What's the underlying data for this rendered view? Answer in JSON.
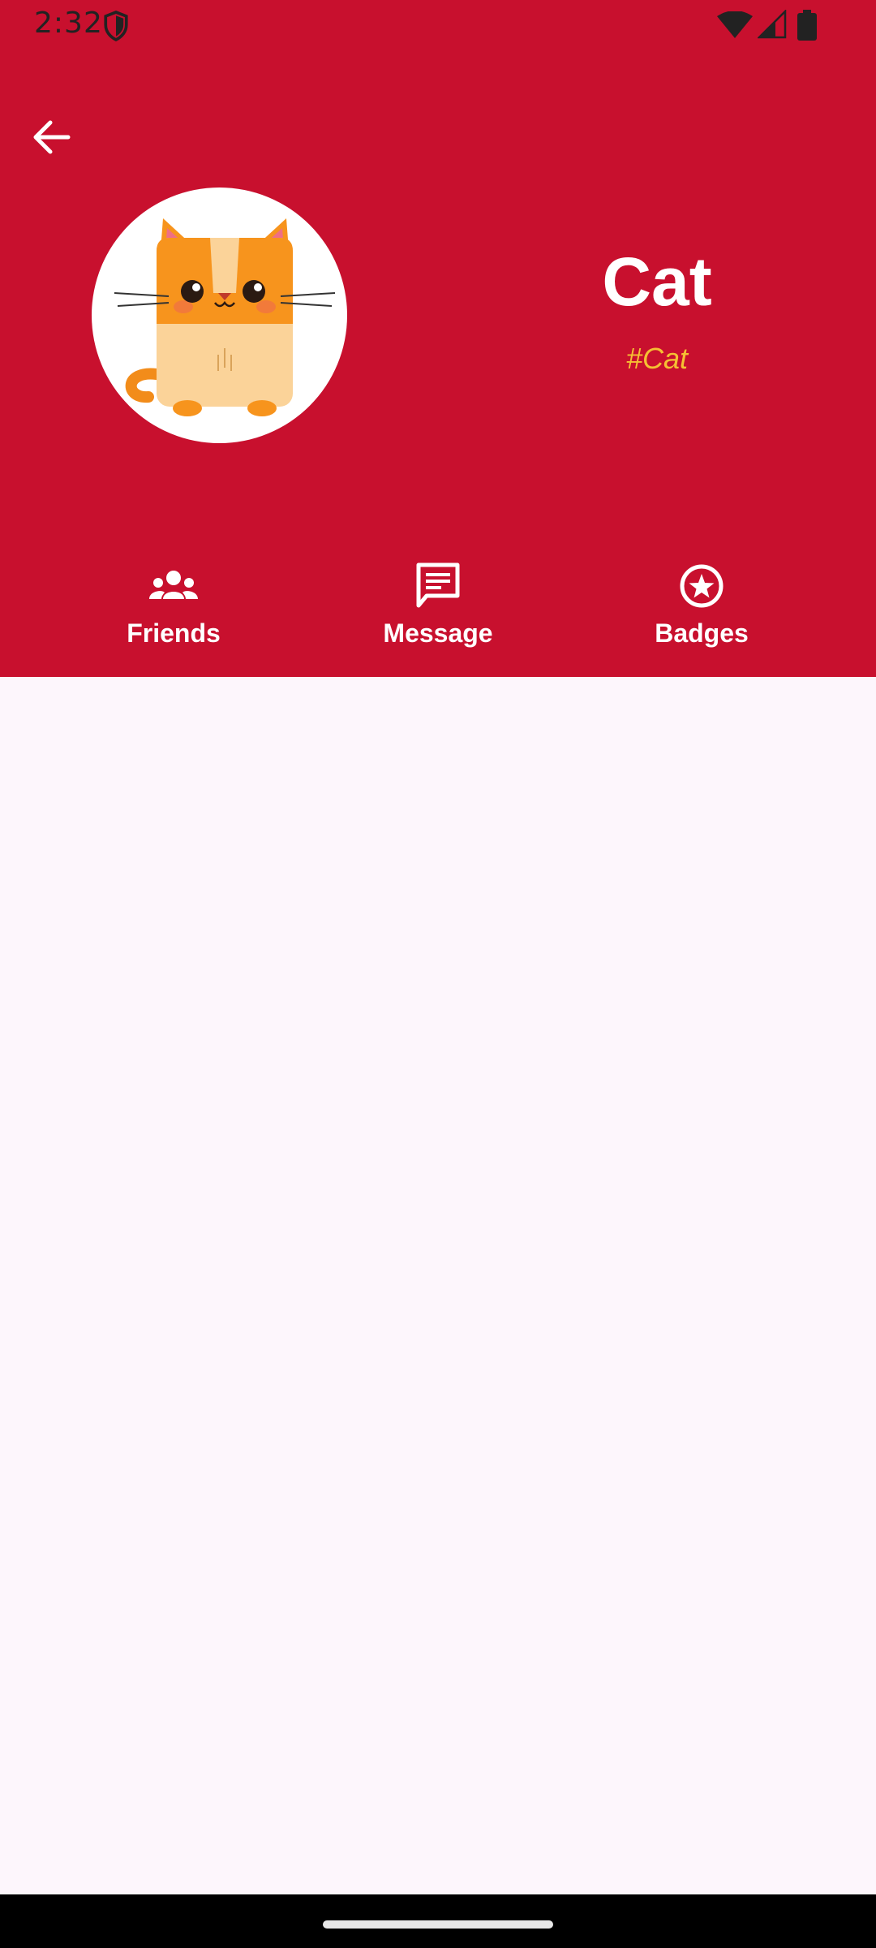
{
  "status_bar": {
    "time": "2:32",
    "icons": [
      "shield-icon",
      "wifi-icon",
      "signal-icon",
      "battery-icon"
    ]
  },
  "header": {
    "background_color": "#c8102e",
    "back_icon": "arrow-back-icon"
  },
  "profile": {
    "name": "Cat",
    "tag": "#Cat",
    "tag_color": "#f5c033",
    "avatar": "cat-avatar"
  },
  "actions": [
    {
      "label": "Friends",
      "icon": "friends-icon"
    },
    {
      "label": "Message",
      "icon": "message-icon"
    },
    {
      "label": "Badges",
      "icon": "badge-star-icon"
    }
  ],
  "content": {
    "background_color": "#fdf6fc"
  }
}
